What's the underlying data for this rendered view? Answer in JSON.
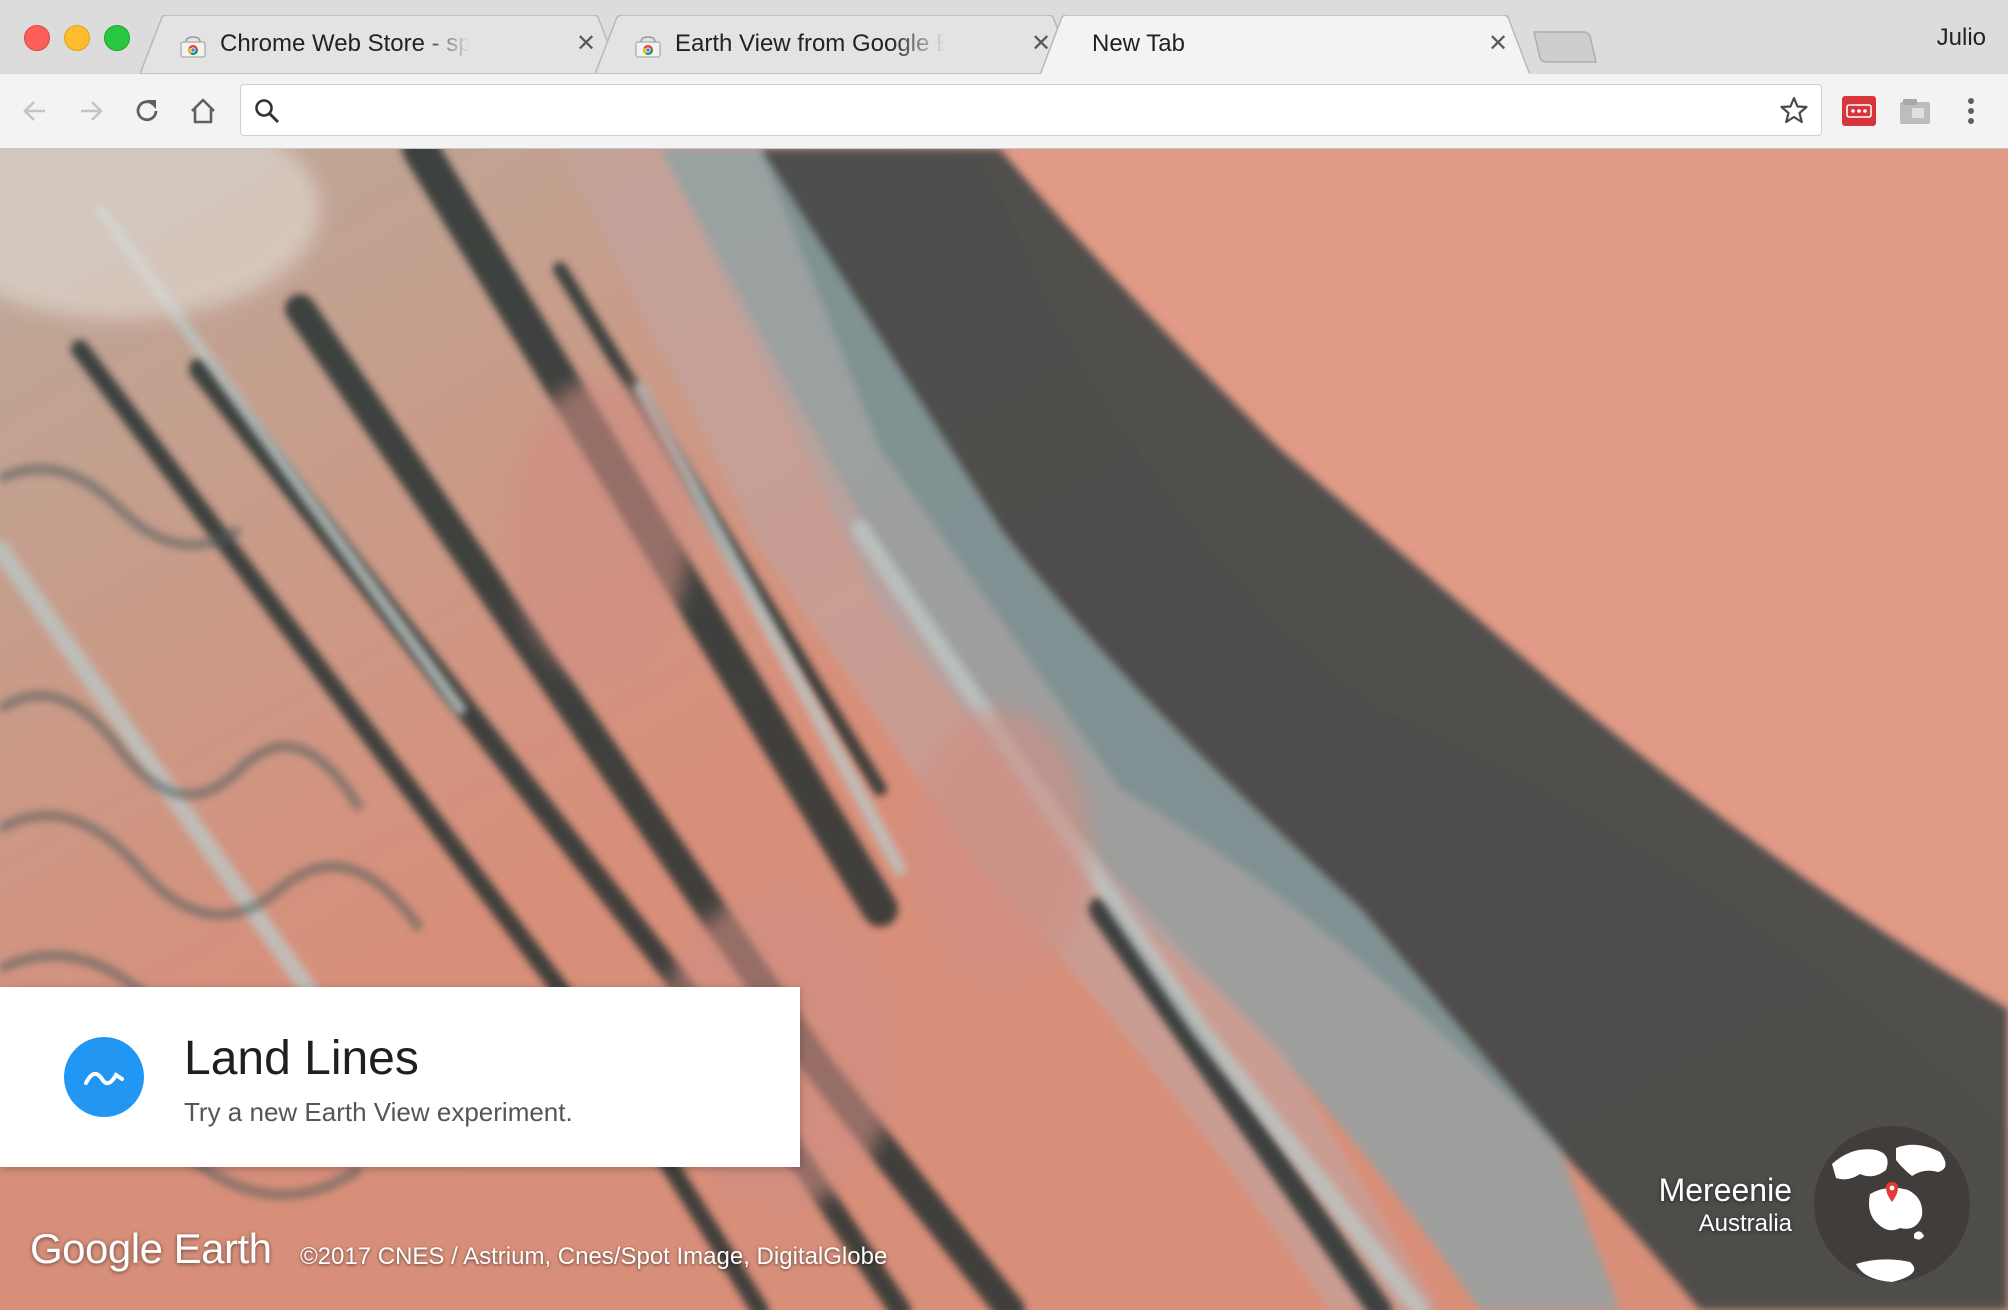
{
  "window": {
    "profile_name": "Julio"
  },
  "tabs": [
    {
      "title": "Chrome Web Store - speed dia",
      "icon": "chrome-web-store-icon",
      "active": false
    },
    {
      "title": "Earth View from Google Earth",
      "icon": "chrome-web-store-icon",
      "active": false
    },
    {
      "title": "New Tab",
      "icon": "",
      "active": true
    }
  ],
  "toolbar": {
    "omnibox_value": "",
    "omnibox_placeholder": "",
    "icons": [
      "back-icon",
      "forward-icon",
      "reload-icon",
      "home-icon",
      "search-icon",
      "bookmark-star-icon",
      "extension-icon",
      "extension-icon",
      "menu-icon"
    ]
  },
  "earth_view": {
    "card": {
      "title": "Land Lines",
      "subtitle": "Try a new Earth View experiment."
    },
    "logo": {
      "text": "Google Earth"
    },
    "attribution": "©2017 CNES / Astrium, Cnes/Spot Image, DigitalGlobe",
    "location": {
      "name": "Mereenie",
      "country": "Australia"
    }
  },
  "colors": {
    "accent_blue": "#2196f3",
    "extension_red": "#d8343c",
    "terrain_sand": "#d98f78",
    "terrain_dark": "#3a4a48"
  }
}
